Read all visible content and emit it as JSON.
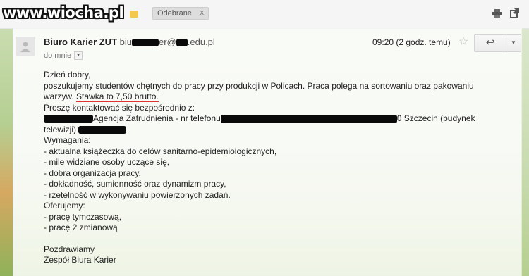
{
  "watermark": "www.wiocha.pl",
  "label": {
    "text": "Odebrane",
    "close": "x"
  },
  "toolbar": {
    "print_icon": "print-icon",
    "newwindow_icon": "new-window-icon"
  },
  "email": {
    "sender_name": "Biuro Karier ZUT",
    "sender_email_prefix": "biu",
    "sender_email_mid": "er@",
    "sender_email_suffix": ".edu.pl",
    "recipient": "do mnie",
    "time": "09:20 (2 godz. temu)",
    "star": "☆",
    "reply": "↩",
    "more": "▼",
    "body": {
      "l1": "Dzień dobry,",
      "l2": "poszukujemy studentów chętnych do pracy przy produkcji w Policach. Praca polega na sortowaniu oraz pakowaniu",
      "l3a": "warzyw. ",
      "l3b": "Stawka to 7,50 brutto.",
      "l4": "Proszę kontaktować się bezpośrednio z:",
      "l5a": "Agencja Zatrudnienia - nr telefonu",
      "l5b": "0 Szczecin (budynek",
      "l6": "telewizji)",
      "l7": "Wymagania:",
      "l8": "- aktualna książeczka do celów sanitarno-epidemiologicznych,",
      "l9": "- mile widziane osoby uczące się,",
      "l10": "- dobra organizacja pracy,",
      "l11": "- dokładność, sumienność oraz dynamizm pracy,",
      "l12": "- rzetelność w wykonywaniu powierzonych zadań.",
      "l13": "Oferujemy:",
      "l14": "- pracę tymczasową,",
      "l15": "- pracę 2 zmianową",
      "l16": "Pozdrawiamy",
      "l17": "Zespół Biura Karier"
    }
  }
}
